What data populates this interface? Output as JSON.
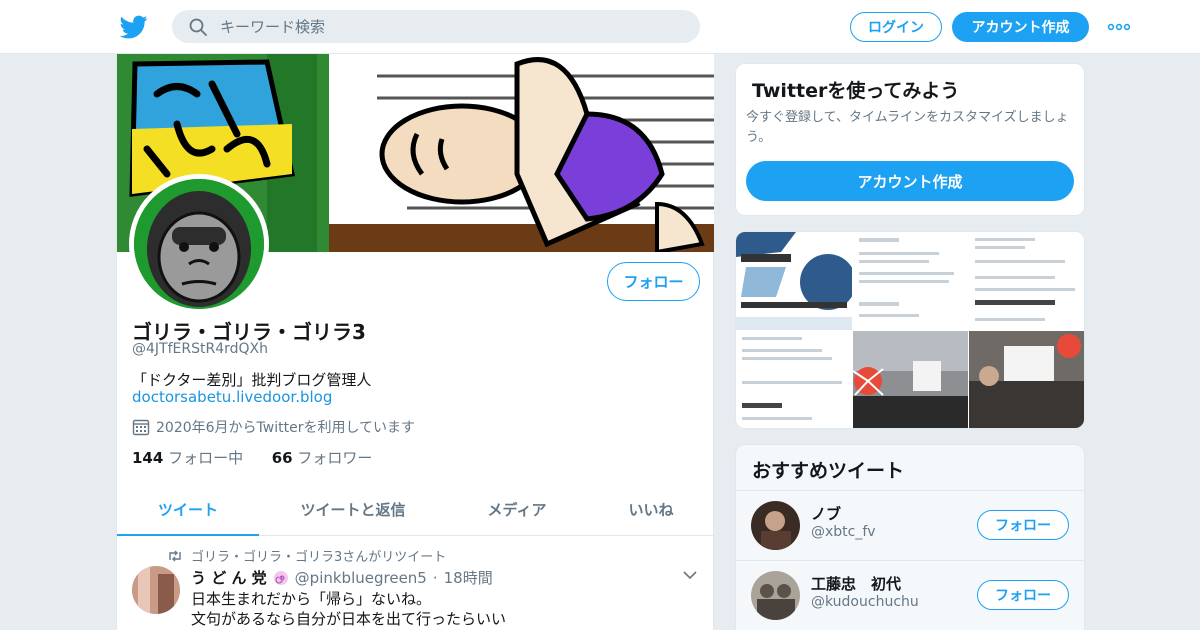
{
  "header": {
    "search_placeholder": "キーワード検索",
    "login_label": "ログイン",
    "signup_label": "アカウント作成"
  },
  "profile": {
    "name": "ゴリラ・ゴリラ・ゴリラ3",
    "handle": "@4JTfERStR4rdQXh",
    "bio": "「ドクター差別」批判ブログ管理人",
    "link": "doctorsabetu.livedoor.blog",
    "joined": "2020年6月からTwitterを利用しています",
    "following_count": "144",
    "following_label": "フォロー中",
    "followers_count": "66",
    "followers_label": "フォロワー",
    "follow_label": "フォロー"
  },
  "tabs": [
    {
      "label": "ツイート",
      "active": true
    },
    {
      "label": "ツイートと返信",
      "active": false
    },
    {
      "label": "メディア",
      "active": false
    },
    {
      "label": "いいね",
      "active": false
    }
  ],
  "tweet": {
    "retweet_context": "ゴリラ・ゴリラ・ゴリラ3さんがリツイート",
    "author_name": "う ど ん 党",
    "author_handle": "@pinkbluegreen5",
    "time": "18時間",
    "lines": [
      "日本生まれだから「帰ら」ないね。",
      "文句があるなら自分が日本を出て行ったらいい"
    ]
  },
  "signup_card": {
    "title": "Twitterを使ってみよう",
    "description": "今すぐ登録して、タイムラインをカスタマイズしましょう。",
    "button_label": "アカウント作成"
  },
  "recommended": {
    "title": "おすすめツイート",
    "follow_label": "フォロー",
    "users": [
      {
        "name": "ノブ",
        "handle": "@xbtc_fv"
      },
      {
        "name": "工藤忠　初代",
        "handle": "@kudouchuchu"
      }
    ]
  },
  "colors": {
    "accent": "#1da1f2",
    "background": "#e6ecf0",
    "secondary_text": "#657786"
  },
  "icons": [
    "twitter-bird-icon",
    "search-icon",
    "more-dots-icon",
    "calendar-icon",
    "retweet-icon",
    "chevron-down-icon"
  ]
}
